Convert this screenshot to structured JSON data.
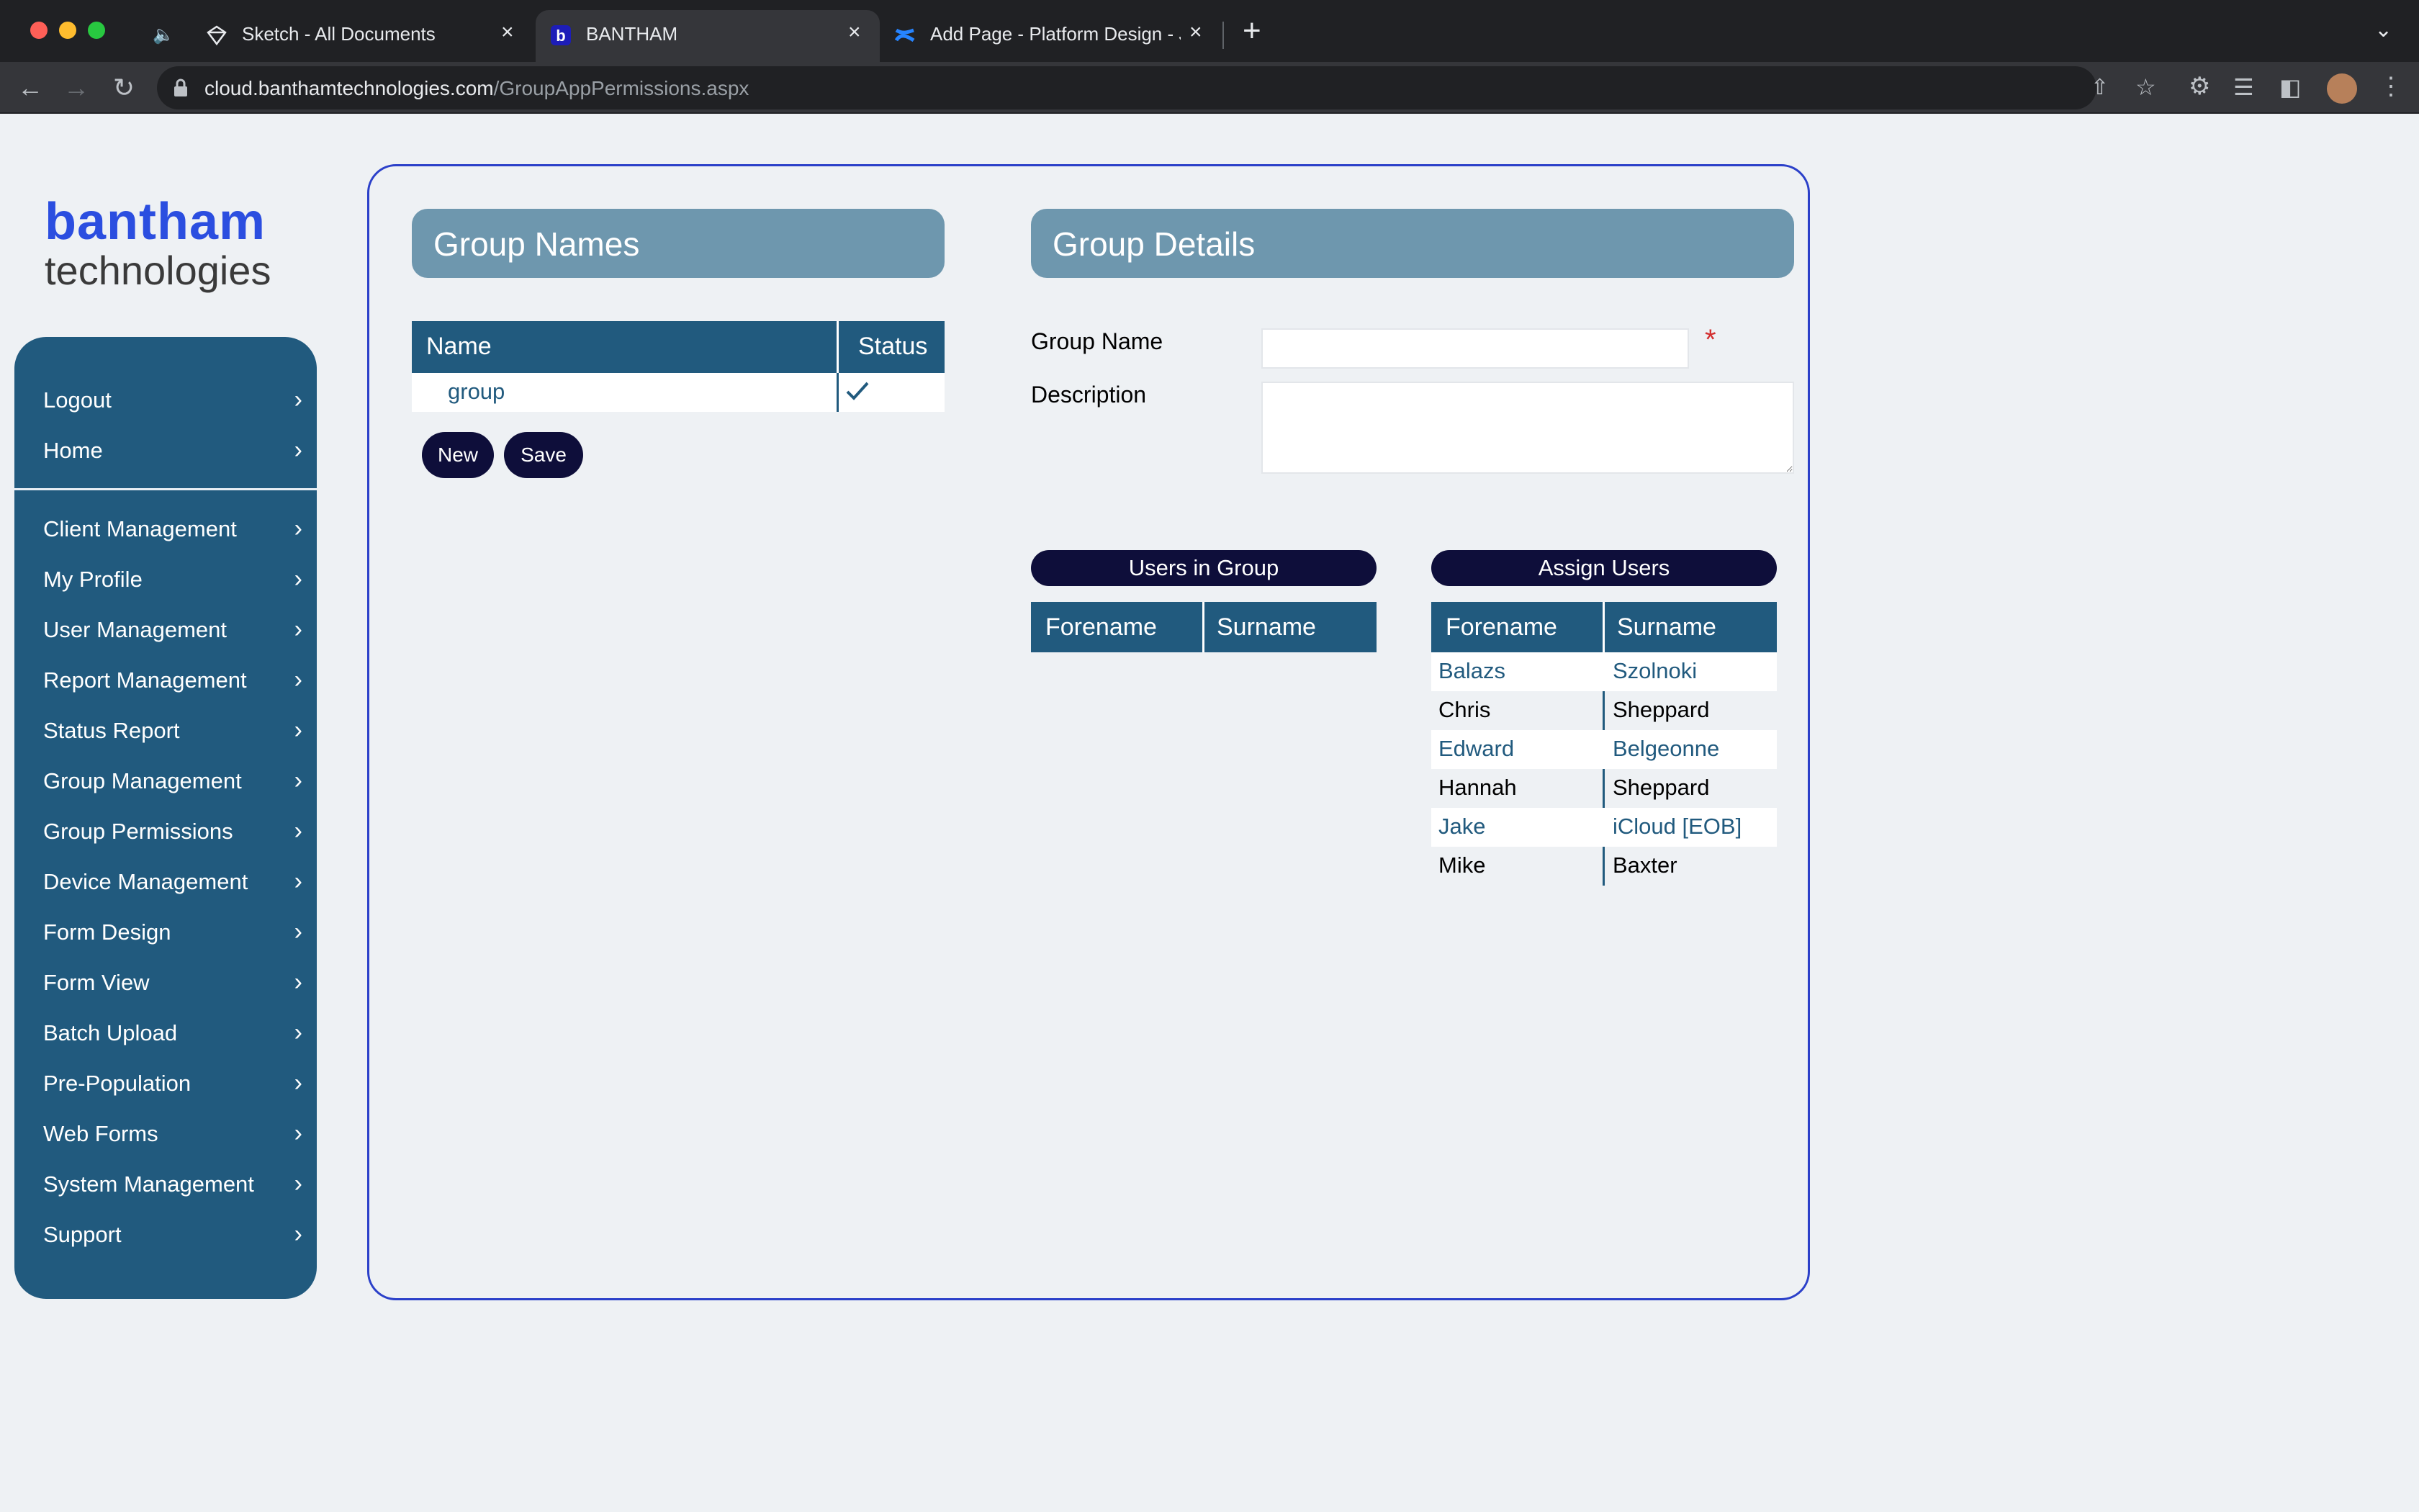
{
  "browser": {
    "tabs": [
      {
        "title": "Sketch - All Documents",
        "icon": "sketch-diamond-icon"
      },
      {
        "title": "BANTHAM",
        "icon": "bantham-b-icon"
      },
      {
        "title": "Add Page - Platform Design - J",
        "icon": "confluence-icon"
      }
    ],
    "url_host": "cloud.banthamtechnologies.com",
    "url_path": "/GroupAppPermissions.aspx"
  },
  "logo": {
    "line1": "bantham",
    "line2": "technologies"
  },
  "sidebar": {
    "top_items": [
      {
        "label": "Logout"
      },
      {
        "label": "Home"
      }
    ],
    "items": [
      {
        "label": "Client Management"
      },
      {
        "label": "My Profile"
      },
      {
        "label": "User Management"
      },
      {
        "label": "Report Management"
      },
      {
        "label": "Status Report"
      },
      {
        "label": "Group Management"
      },
      {
        "label": "Group Permissions"
      },
      {
        "label": "Device Management"
      },
      {
        "label": "Form Design"
      },
      {
        "label": "Form View"
      },
      {
        "label": "Batch Upload"
      },
      {
        "label": "Pre-Population"
      },
      {
        "label": "Web Forms"
      },
      {
        "label": "System Management"
      },
      {
        "label": "Support"
      }
    ]
  },
  "group_names": {
    "title": "Group Names",
    "columns": {
      "name": "Name",
      "status": "Status"
    },
    "rows": [
      {
        "name": "group",
        "status_icon": "checkmark-icon"
      }
    ],
    "new_label": "New",
    "save_label": "Save"
  },
  "group_details": {
    "title": "Group Details",
    "group_name_label": "Group Name",
    "group_name_value": "",
    "required_mark": "*",
    "description_label": "Description",
    "description_value": ""
  },
  "users_in_group": {
    "title": "Users in Group",
    "columns": {
      "forename": "Forename",
      "surname": "Surname"
    },
    "rows": []
  },
  "assign_users": {
    "title": "Assign Users",
    "columns": {
      "forename": "Forename",
      "surname": "Surname"
    },
    "rows": [
      {
        "forename": "Balazs",
        "surname": "Szolnoki"
      },
      {
        "forename": "Chris",
        "surname": "Sheppard"
      },
      {
        "forename": "Edward",
        "surname": "Belgeonne"
      },
      {
        "forename": "Hannah",
        "surname": "Sheppard"
      },
      {
        "forename": "Jake",
        "surname": "iCloud [EOB]"
      },
      {
        "forename": "Mike",
        "surname": "Baxter"
      }
    ]
  },
  "colors": {
    "sidebar": "#215a7e",
    "section_header": "#6e97ae",
    "dark_button": "#0e0e3a",
    "panel_border": "#2b40c9",
    "link_text": "#215a7e",
    "required": "#d32f2f"
  }
}
